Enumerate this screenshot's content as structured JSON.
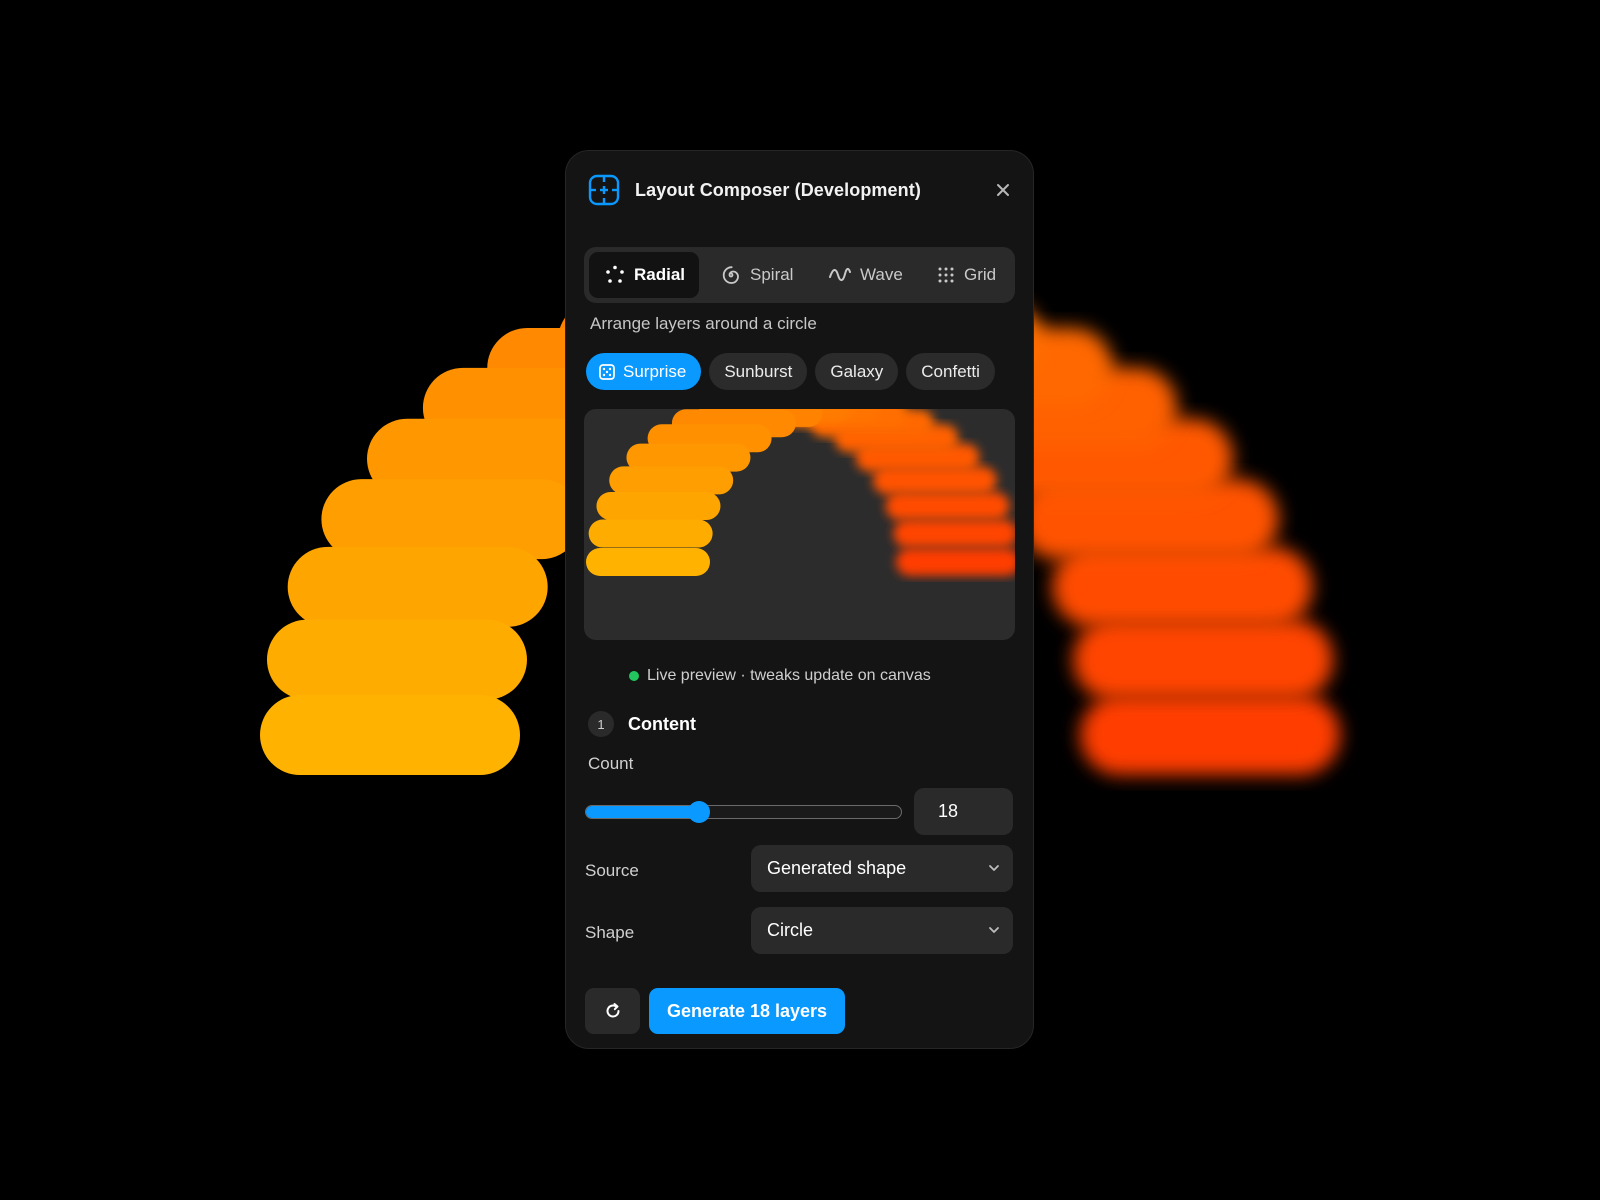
{
  "window": {
    "title": "Layout Composer (Development)",
    "close_icon": "close-icon",
    "app_icon": "crosshair-frame-icon"
  },
  "tabs": [
    {
      "label": "Radial",
      "icon": "dots-radial-icon",
      "active": true
    },
    {
      "label": "Spiral",
      "icon": "spiral-icon",
      "active": false
    },
    {
      "label": "Wave",
      "icon": "wave-icon",
      "active": false
    },
    {
      "label": "Grid",
      "icon": "dot-grid-icon",
      "active": false
    }
  ],
  "mode_description": "Arrange layers around a circle",
  "presets": [
    {
      "label": "Surprise",
      "icon": "dice-icon",
      "active": true
    },
    {
      "label": "Sunburst",
      "active": false
    },
    {
      "label": "Galaxy",
      "active": false
    },
    {
      "label": "Confetti",
      "active": false
    }
  ],
  "status": {
    "text": "Live preview · tweaks update on canvas",
    "color": "#22c55e"
  },
  "section": {
    "number": "1",
    "title": "Content"
  },
  "count": {
    "label": "Count",
    "value": "18",
    "slider_fraction": 0.36
  },
  "source": {
    "label": "Source",
    "value": "Generated shape"
  },
  "shape": {
    "label": "Shape",
    "value": "Circle"
  },
  "actions": {
    "refresh_icon": "refresh-icon",
    "generate_label": "Generate 18 layers"
  },
  "colors": {
    "accent": "#0a99ff",
    "gradient_start": "#ffb300",
    "gradient_end": "#ff3d00",
    "panel": "#141414"
  }
}
